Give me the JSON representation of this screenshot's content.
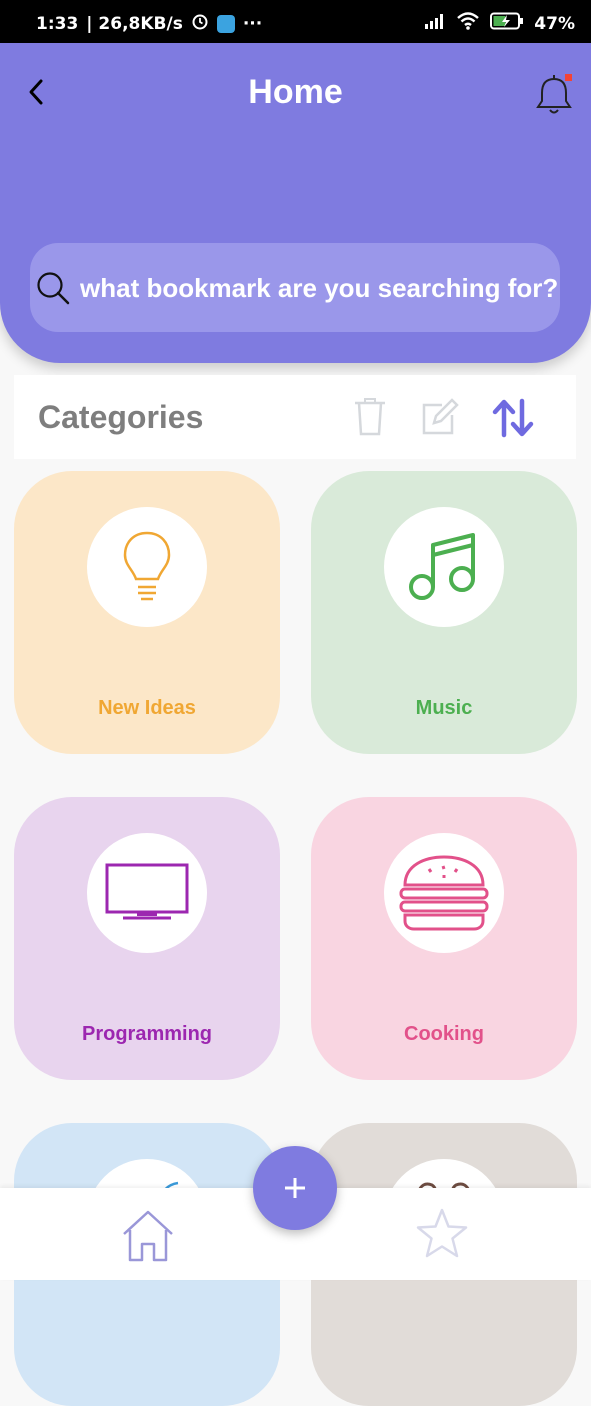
{
  "statusbar": {
    "time": "1:33",
    "speed": "| 26,8KB/s",
    "more": "···",
    "battery": "47%"
  },
  "header": {
    "title": "Home"
  },
  "search": {
    "placeholder": "what bookmark are you searching for?"
  },
  "categories": {
    "title": "Categories",
    "items": [
      {
        "label": "New Ideas",
        "icon": "lightbulb-icon",
        "bg": "#fce7c8",
        "color": "#f0a733"
      },
      {
        "label": "Music",
        "icon": "music-note-icon",
        "bg": "#d9ead9",
        "color": "#4caf50"
      },
      {
        "label": "Programming",
        "icon": "monitor-icon",
        "bg": "#e8d4ee",
        "color": "#9c27b0"
      },
      {
        "label": "Cooking",
        "icon": "burger-icon",
        "bg": "#f9d5e1",
        "color": "#e2518a"
      },
      {
        "label": "",
        "icon": "feather-icon",
        "bg": "#d2e5f6",
        "color": "#3a9ad9"
      },
      {
        "label": "",
        "icon": "glasses-icon",
        "bg": "#e1dcd8",
        "color": "#6d4c41"
      }
    ]
  },
  "colors": {
    "accent": "#7f7be0"
  }
}
